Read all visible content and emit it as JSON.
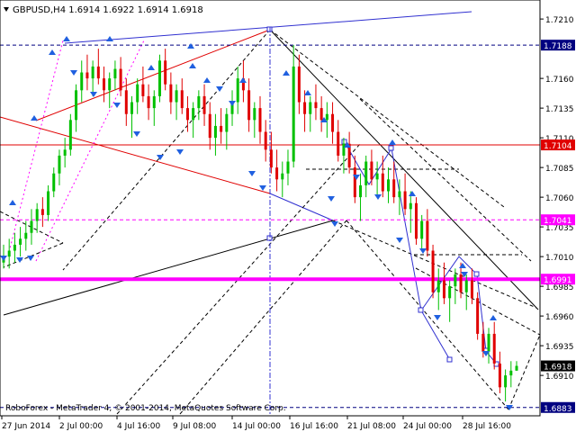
{
  "header": {
    "symbol_line": "GBPUSD,H4  1.6914 1.6922 1.6914 1.6918",
    "dropdown_icon": "triangle-down-icon"
  },
  "footer": {
    "copyright": "RoboForex - MetaTrader 4, © 2001-2014, MetaQuotes Software Corp."
  },
  "colors": {
    "background": "#ffffff",
    "bull_candle": "#00c000",
    "bear_candle": "#e00000",
    "grid_border": "#000000",
    "resistance_line": "#e00000",
    "target_magenta": "#ff00ff",
    "blue_lines": "#3030d0",
    "black_channel": "#000000",
    "arrow_blue": "#2060e0"
  },
  "chart_data": {
    "type": "candlestick",
    "symbol": "GBPUSD",
    "timeframe": "H4",
    "ohlc_header": {
      "open": 1.6914,
      "high": 1.6922,
      "low": 1.6914,
      "close": 1.6918
    },
    "ylim": [
      1.6876,
      1.7226
    ],
    "y_ticks": [
      "1.7210",
      "1.7160",
      "1.7135",
      "1.7110",
      "1.7085",
      "1.7060",
      "1.7035",
      "1.7010",
      "1.6985",
      "1.6960",
      "1.6935",
      "1.6910"
    ],
    "x_ticks": [
      "27 Jun 2014",
      "2 Jul 00:00",
      "4 Jul 16:00",
      "9 Jul 08:00",
      "14 Jul 00:00",
      "16 Jul 16:00",
      "21 Jul 08:00",
      "24 Jul 00:00",
      "28 Jul 16:00"
    ],
    "levels": [
      {
        "label": "1.7188",
        "value": 1.7188,
        "style": "dashed",
        "color": "#000080"
      },
      {
        "label": "1.7104",
        "value": 1.7104,
        "style": "solid",
        "color": "#e00000"
      },
      {
        "label": "1.7041",
        "value": 1.7041,
        "style": "dashed",
        "color": "#ff00ff"
      },
      {
        "label": "1.6991",
        "value": 1.6991,
        "style": "thick",
        "color": "#ff00ff"
      },
      {
        "label": "1.6918",
        "value": 1.6918,
        "style": "price",
        "color": "#000000"
      },
      {
        "label": "1.6883",
        "value": 1.6883,
        "style": "dashed",
        "color": "#000080"
      }
    ],
    "candles": [
      [
        1.7005,
        1.702,
        1.7,
        1.701
      ],
      [
        1.701,
        1.7025,
        1.7,
        1.7015
      ],
      [
        1.7015,
        1.703,
        1.7005,
        1.702
      ],
      [
        1.702,
        1.7035,
        1.701,
        1.7025
      ],
      [
        1.7025,
        1.704,
        1.7015,
        1.703
      ],
      [
        1.703,
        1.705,
        1.702,
        1.704
      ],
      [
        1.704,
        1.7055,
        1.703,
        1.705
      ],
      [
        1.705,
        1.706,
        1.7035,
        1.7045
      ],
      [
        1.7045,
        1.707,
        1.704,
        1.7065
      ],
      [
        1.7065,
        1.7085,
        1.706,
        1.708
      ],
      [
        1.708,
        1.71,
        1.707,
        1.7095
      ],
      [
        1.7095,
        1.711,
        1.7085,
        1.71
      ],
      [
        1.71,
        1.713,
        1.7095,
        1.7125
      ],
      [
        1.7125,
        1.7155,
        1.7115,
        1.715
      ],
      [
        1.715,
        1.7175,
        1.714,
        1.7165
      ],
      [
        1.7165,
        1.718,
        1.715,
        1.716
      ],
      [
        1.716,
        1.7175,
        1.7145,
        1.717
      ],
      [
        1.717,
        1.7185,
        1.7155,
        1.716
      ],
      [
        1.716,
        1.717,
        1.714,
        1.715
      ],
      [
        1.715,
        1.7165,
        1.7135,
        1.716
      ],
      [
        1.716,
        1.7175,
        1.715,
        1.7168
      ],
      [
        1.7168,
        1.7178,
        1.7145,
        1.715
      ],
      [
        1.715,
        1.716,
        1.712,
        1.713
      ],
      [
        1.713,
        1.7145,
        1.711,
        1.714
      ],
      [
        1.714,
        1.716,
        1.713,
        1.7155
      ],
      [
        1.7155,
        1.717,
        1.714,
        1.7145
      ],
      [
        1.7145,
        1.7155,
        1.7125,
        1.7135
      ],
      [
        1.7135,
        1.715,
        1.712,
        1.7145
      ],
      [
        1.7145,
        1.718,
        1.714,
        1.7175
      ],
      [
        1.7175,
        1.7185,
        1.715,
        1.7155
      ],
      [
        1.7155,
        1.7165,
        1.713,
        1.714
      ],
      [
        1.714,
        1.7155,
        1.7125,
        1.715
      ],
      [
        1.715,
        1.716,
        1.713,
        1.7135
      ],
      [
        1.7135,
        1.7145,
        1.7115,
        1.7125
      ],
      [
        1.7125,
        1.714,
        1.711,
        1.7135
      ],
      [
        1.7135,
        1.715,
        1.7125,
        1.7145
      ],
      [
        1.7145,
        1.7155,
        1.712,
        1.713
      ],
      [
        1.713,
        1.714,
        1.71,
        1.711
      ],
      [
        1.711,
        1.713,
        1.7095,
        1.712
      ],
      [
        1.712,
        1.7135,
        1.7105,
        1.7115
      ],
      [
        1.7115,
        1.7135,
        1.71,
        1.713
      ],
      [
        1.713,
        1.715,
        1.712,
        1.714
      ],
      [
        1.714,
        1.717,
        1.713,
        1.716
      ],
      [
        1.716,
        1.7175,
        1.714,
        1.715
      ],
      [
        1.715,
        1.716,
        1.7115,
        1.7125
      ],
      [
        1.7125,
        1.714,
        1.711,
        1.7135
      ],
      [
        1.7135,
        1.7145,
        1.7105,
        1.7115
      ],
      [
        1.7115,
        1.7125,
        1.709,
        1.71
      ],
      [
        1.71,
        1.7115,
        1.708,
        1.7085
      ],
      [
        1.7085,
        1.71,
        1.7065,
        1.7075
      ],
      [
        1.7075,
        1.709,
        1.706,
        1.708
      ],
      [
        1.708,
        1.71,
        1.707,
        1.709
      ],
      [
        1.709,
        1.7188,
        1.7085,
        1.717
      ],
      [
        1.717,
        1.718,
        1.713,
        1.714
      ],
      [
        1.714,
        1.715,
        1.7115,
        1.713
      ],
      [
        1.713,
        1.7145,
        1.7115,
        1.714
      ],
      [
        1.714,
        1.7155,
        1.7125,
        1.7135
      ],
      [
        1.7135,
        1.7145,
        1.7115,
        1.7125
      ],
      [
        1.7125,
        1.714,
        1.711,
        1.713
      ],
      [
        1.713,
        1.714,
        1.7105,
        1.7115
      ],
      [
        1.7115,
        1.7125,
        1.709,
        1.7095
      ],
      [
        1.7095,
        1.711,
        1.708,
        1.7105
      ],
      [
        1.7105,
        1.7115,
        1.708,
        1.7085
      ],
      [
        1.7085,
        1.7095,
        1.7055,
        1.706
      ],
      [
        1.706,
        1.708,
        1.704,
        1.707
      ],
      [
        1.707,
        1.7095,
        1.706,
        1.709
      ],
      [
        1.709,
        1.71,
        1.707,
        1.7075
      ],
      [
        1.7075,
        1.709,
        1.706,
        1.708
      ],
      [
        1.708,
        1.7095,
        1.706,
        1.7065
      ],
      [
        1.7065,
        1.7085,
        1.7055,
        1.7075
      ],
      [
        1.7075,
        1.709,
        1.7055,
        1.706
      ],
      [
        1.706,
        1.7075,
        1.7045,
        1.7065
      ],
      [
        1.7065,
        1.708,
        1.7045,
        1.705
      ],
      [
        1.705,
        1.7065,
        1.703,
        1.7055
      ],
      [
        1.7055,
        1.706,
        1.702,
        1.7025
      ],
      [
        1.7025,
        1.7045,
        1.7015,
        1.704
      ],
      [
        1.704,
        1.705,
        1.701,
        1.7015
      ],
      [
        1.7015,
        1.702,
        1.6975,
        1.698
      ],
      [
        1.698,
        1.7,
        1.6965,
        1.699
      ],
      [
        1.699,
        1.7005,
        1.697,
        1.6975
      ],
      [
        1.6975,
        1.699,
        1.6955,
        1.6985
      ],
      [
        1.6985,
        1.7,
        1.697,
        1.6995
      ],
      [
        1.6995,
        1.7005,
        1.6975,
        1.698
      ],
      [
        1.698,
        1.6995,
        1.6965,
        1.699
      ],
      [
        1.699,
        1.7,
        1.697,
        1.6975
      ],
      [
        1.6975,
        1.698,
        1.694,
        1.6945
      ],
      [
        1.6945,
        1.6955,
        1.6925,
        1.693
      ],
      [
        1.693,
        1.695,
        1.692,
        1.6945
      ],
      [
        1.6945,
        1.6955,
        1.6915,
        1.692
      ],
      [
        1.692,
        1.693,
        1.6895,
        1.69
      ],
      [
        1.69,
        1.6915,
        1.6888,
        1.691
      ],
      [
        1.691,
        1.6922,
        1.69,
        1.6914
      ],
      [
        1.6914,
        1.6922,
        1.6914,
        1.6918
      ]
    ]
  }
}
